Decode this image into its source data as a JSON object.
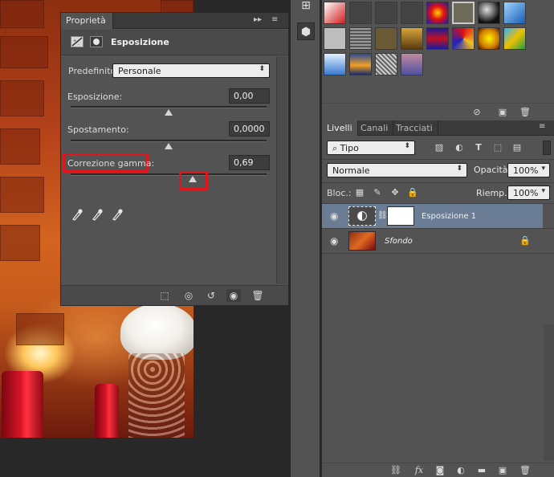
{
  "properties": {
    "tab_label": "Proprietà",
    "collapse_glyph": "▸▸",
    "menu_glyph": "≡",
    "title": "Esposizione",
    "preset_label": "Predefinito:",
    "preset_value": "Personale",
    "exposure_label": "Esposizione:",
    "exposure_value": "0,00",
    "offset_label": "Spostamento:",
    "offset_value": "0,0000",
    "gamma_label": "Correzione gamma:",
    "gamma_value": "0,69",
    "highlight_color": "#e0161b"
  },
  "layers": {
    "tabs": [
      "Livelli",
      "Canali",
      "Tracciati"
    ],
    "filter_value": "Tipo",
    "blend_mode": "Normale",
    "opacity_label": "Opacità:",
    "opacity_value": "100%",
    "lock_label": "Bloc.:",
    "fill_label": "Riemp.:",
    "fill_value": "100%",
    "items": [
      {
        "name": "Esposizione 1",
        "selected": true
      },
      {
        "name": "Sfondo",
        "selected": false,
        "locked": true
      }
    ],
    "footer_icons": [
      "link-icon",
      "fx-icon",
      "mask-icon",
      "adjustment-icon",
      "folder-icon",
      "new-layer-icon",
      "trash-icon"
    ],
    "fx_label": "fx"
  },
  "icons": {
    "eyedropper": "eyedropper-icon",
    "eye": "eye-icon",
    "lock": "lock-icon"
  }
}
